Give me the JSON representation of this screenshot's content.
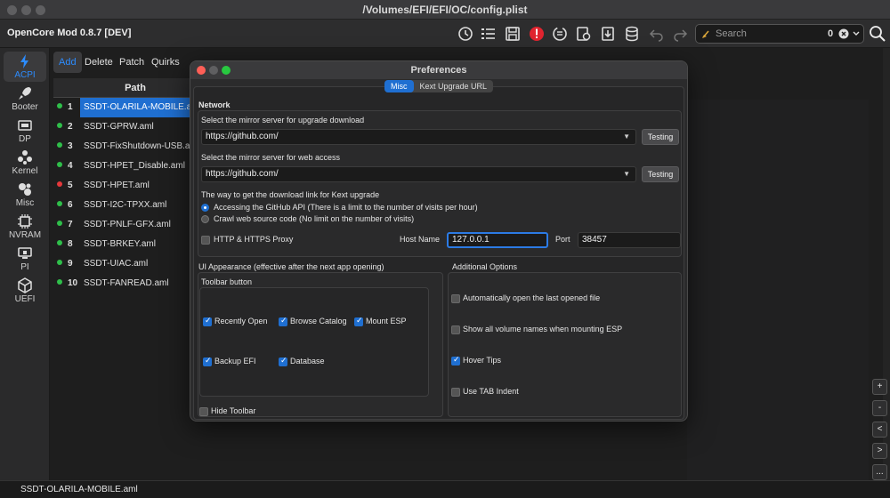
{
  "window": {
    "title": "/Volumes/EFI/EFI/OC/config.plist"
  },
  "toolbar": {
    "app_name": "OpenCore Mod 0.8.7 [DEV]",
    "search_placeholder": "Search",
    "search_count": "0"
  },
  "sidebar": {
    "items": [
      {
        "label": "ACPI",
        "icon": "lightning-icon"
      },
      {
        "label": "Booter",
        "icon": "rocket-icon"
      },
      {
        "label": "DP",
        "icon": "device-properties-icon"
      },
      {
        "label": "Kernel",
        "icon": "kernel-icon"
      },
      {
        "label": "Misc",
        "icon": "misc-icon"
      },
      {
        "label": "NVRAM",
        "icon": "chip-icon"
      },
      {
        "label": "PI",
        "icon": "platform-info-icon"
      },
      {
        "label": "UEFI",
        "icon": "cube-icon"
      }
    ]
  },
  "subtabs": [
    "Add",
    "Delete",
    "Patch",
    "Quirks"
  ],
  "table": {
    "path_header": "Path",
    "rows": [
      {
        "index": "1",
        "path": "SSDT-OLARILA-MOBILE.aml",
        "status": "green"
      },
      {
        "index": "2",
        "path": "SSDT-GPRW.aml",
        "status": "green"
      },
      {
        "index": "3",
        "path": "SSDT-FixShutdown-USB.aml",
        "status": "green"
      },
      {
        "index": "4",
        "path": "SSDT-HPET_Disable.aml",
        "status": "green"
      },
      {
        "index": "5",
        "path": "SSDT-HPET.aml",
        "status": "red"
      },
      {
        "index": "6",
        "path": "SSDT-I2C-TPXX.aml",
        "status": "green"
      },
      {
        "index": "7",
        "path": "SSDT-PNLF-GFX.aml",
        "status": "green"
      },
      {
        "index": "8",
        "path": "SSDT-BRKEY.aml",
        "status": "green"
      },
      {
        "index": "9",
        "path": "SSDT-UIAC.aml",
        "status": "green"
      },
      {
        "index": "10",
        "path": "SSDT-FANREAD.aml",
        "status": "green"
      }
    ]
  },
  "side_buttons": [
    "+",
    "-",
    "<",
    ">",
    "..."
  ],
  "statusbar": {
    "text": "SSDT-OLARILA-MOBILE.aml"
  },
  "preferences": {
    "title": "Preferences",
    "tabs": [
      "Misc",
      "Kext Upgrade URL"
    ],
    "network_label": "Network",
    "mirror_upgrade_label": "Select the mirror server for upgrade download",
    "mirror_upgrade_value": "https://github.com/",
    "mirror_web_label": "Select the mirror server for web access",
    "mirror_web_value": "https://github.com/",
    "testing_label": "Testing",
    "kext_method_label": "The way to get the download link for Kext upgrade",
    "radio_api": "Accessing the GitHub API (There is a limit to the number of visits per hour)",
    "radio_crawl": "Crawl web source code (No limit on the number of visits)",
    "proxy_label": "HTTP & HTTPS Proxy",
    "host_label": "Host Name",
    "host_value": "127.0.0.1",
    "port_label": "Port",
    "port_value": "38457",
    "ui_appearance_label": "UI Appearance (effective after the next app opening)",
    "toolbar_button_label": "Toolbar button",
    "toolbar_options": {
      "recently_open": {
        "label": "Recently Open",
        "checked": true
      },
      "browse_catalog": {
        "label": "Browse Catalog",
        "checked": true
      },
      "mount_esp": {
        "label": "Mount ESP",
        "checked": true
      },
      "backup_efi": {
        "label": "Backup EFI",
        "checked": true
      },
      "database": {
        "label": "Database",
        "checked": true
      }
    },
    "hide_toolbar_label": "Hide Toolbar",
    "additional_label": "Additional Options",
    "additional": {
      "auto_open": "Automatically open the last opened file",
      "show_volumes": "Show all volume names when mounting ESP",
      "hover_tips": "Hover Tips",
      "tab_indent": "Use TAB Indent"
    }
  }
}
